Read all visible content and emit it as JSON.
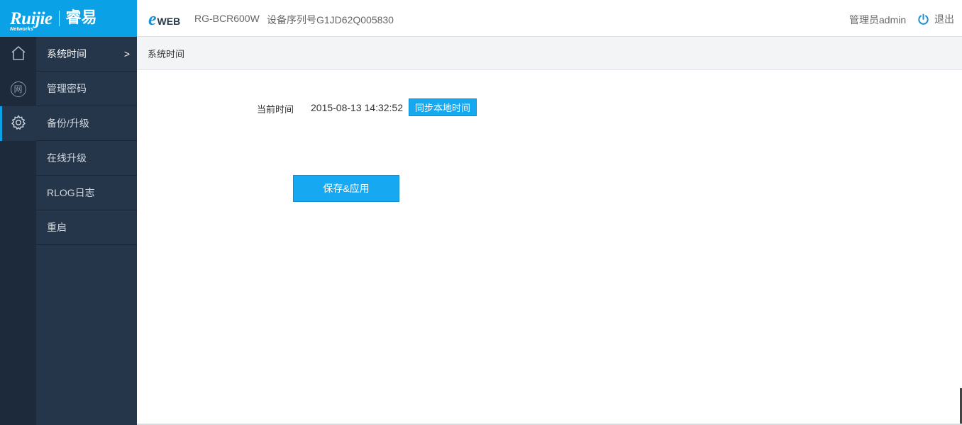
{
  "header": {
    "logo_brand": "Ruijie",
    "logo_brand_sub": "Networks",
    "logo_cn": "睿易",
    "eweb_e": "e",
    "eweb_rest": "WEB",
    "device_model": "RG-BCR600W",
    "device_serial": "设备序列号G1JD62Q005830",
    "user": "管理员admin",
    "logout": "退出"
  },
  "rail": {
    "items": [
      {
        "icon": "home-icon",
        "active": false
      },
      {
        "icon": "network-icon",
        "glyph": "网",
        "active": false
      },
      {
        "icon": "gear-icon",
        "active": true
      }
    ]
  },
  "submenu": {
    "items": [
      {
        "label": "系统时间",
        "active": true,
        "arrow": ">"
      },
      {
        "label": "管理密码"
      },
      {
        "label": "备份/升级"
      },
      {
        "label": "在线升级"
      },
      {
        "label": "RLOG日志"
      },
      {
        "label": "重启"
      }
    ]
  },
  "breadcrumb": "系统时间",
  "main": {
    "time_label": "当前时间",
    "time_value": "2015-08-13 14:32:52",
    "sync_button": "同步本地时间",
    "save_button": "保存&应用"
  },
  "colors": {
    "accent": "#0ba1e6",
    "sidebar_dark": "#1c2a3b",
    "sidebar": "#26364a",
    "button": "#16a8f0"
  }
}
